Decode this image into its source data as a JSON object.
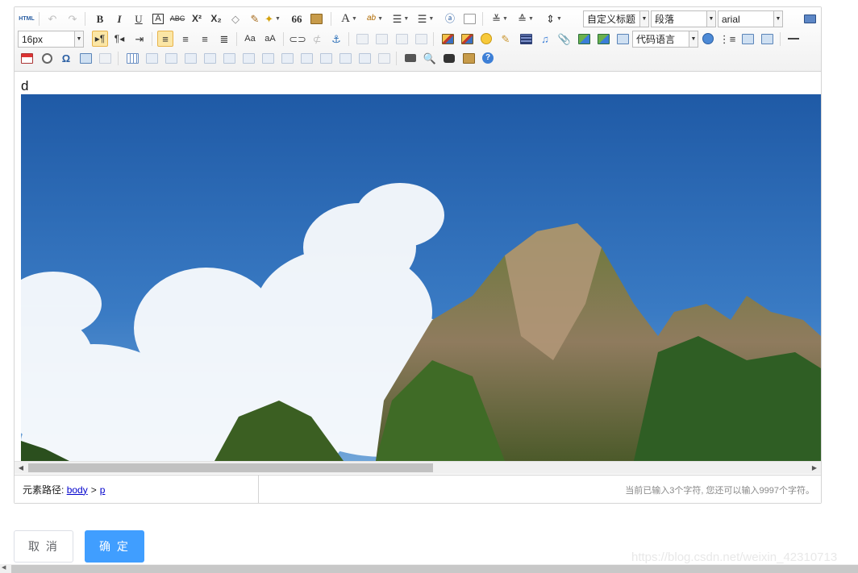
{
  "toolbar": {
    "html_label": "HTML",
    "bold_label": "B",
    "italic_label": "I",
    "underline_label": "U",
    "superscript_label": "X²",
    "subscript_label": "X₂",
    "font_color_label": "A",
    "quote_label": "66",
    "title_select": "自定义标题",
    "paragraph_select": "段落",
    "font_family_select": "arial",
    "font_size_select": "16px",
    "code_language_select": "代码语言",
    "special_char_label": "Ω",
    "help_label": "?"
  },
  "document": {
    "text": "d",
    "image_alt": "karst mountains with clouds"
  },
  "statusbar": {
    "path_label": "元素路径:",
    "path_items": [
      "body",
      "p"
    ],
    "path_separator": ">",
    "word_count": "当前已输入3个字符, 您还可以输入9997个字符。"
  },
  "buttons": {
    "cancel": "取 消",
    "confirm": "确 定"
  },
  "watermark": "https://blog.csdn.net/weixin_42310713",
  "colors": {
    "primary": "#409eff",
    "active_button_bg": "#fbe6a5",
    "link": "#0000cc"
  }
}
